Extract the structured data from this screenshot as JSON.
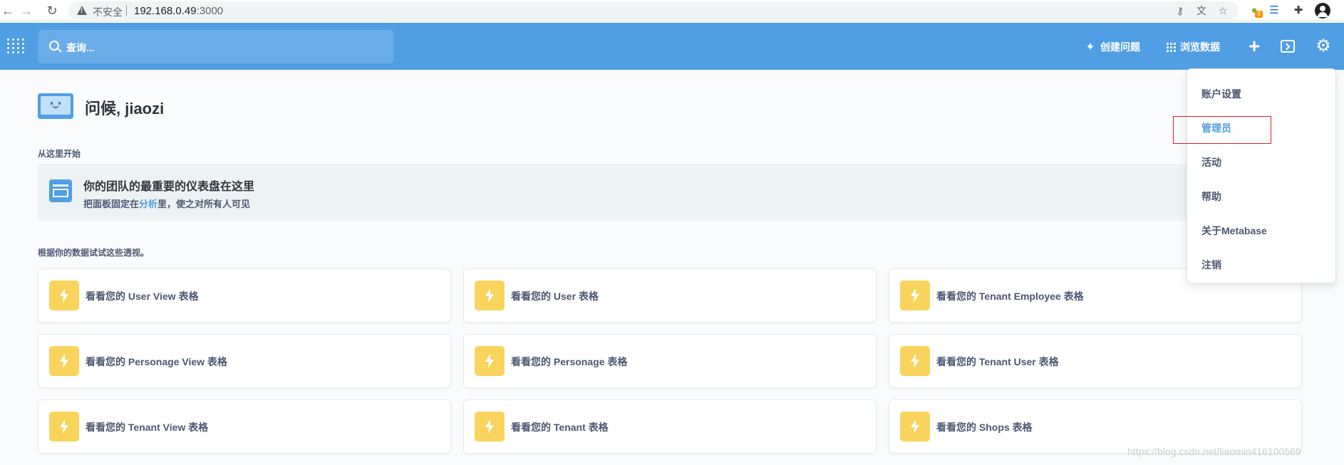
{
  "browser": {
    "insecure_label": "不安全",
    "url_host": "192.168.0.49",
    "url_port": ":3000",
    "extension_badge": "3"
  },
  "header": {
    "search_placeholder": "查询...",
    "create_question_label": "创建问题",
    "browse_data_label": "浏览数据",
    "plus_symbol": "+",
    "settings_icon": "gear-icon"
  },
  "greeting": {
    "text": "问候, jiaozi"
  },
  "start_here": {
    "section_label": "从这里开始",
    "title": "你的团队的最重要的仪表盘在这里",
    "subtitle_prefix": "把面板固定在",
    "subtitle_link": "分析",
    "subtitle_suffix": "里，使之对所有人可见"
  },
  "xrays": {
    "section_label": "根据你的数据试试这些透视。",
    "items": [
      {
        "label": "看看您的 User View 表格"
      },
      {
        "label": "看看您的 User 表格"
      },
      {
        "label": "看看您的 Tenant Employee 表格"
      },
      {
        "label": "看看您的 Personage View 表格"
      },
      {
        "label": "看看您的 Personage 表格"
      },
      {
        "label": "看看您的 Tenant User 表格"
      },
      {
        "label": "看看您的 Tenant View 表格"
      },
      {
        "label": "看看您的 Tenant 表格"
      },
      {
        "label": "看看您的 Shops 表格"
      }
    ]
  },
  "menu": {
    "items": [
      {
        "label": "账户设置"
      },
      {
        "label": "管理员"
      },
      {
        "label": "活动"
      },
      {
        "label": "帮助"
      },
      {
        "label": "关于Metabase"
      },
      {
        "label": "注销"
      }
    ]
  },
  "watermark": "https://blog.csdn.net/liaomin416100569",
  "colors": {
    "brand": "#509ee3",
    "xray_bolt": "#f9d45c",
    "highlight_border": "#e0202b"
  }
}
